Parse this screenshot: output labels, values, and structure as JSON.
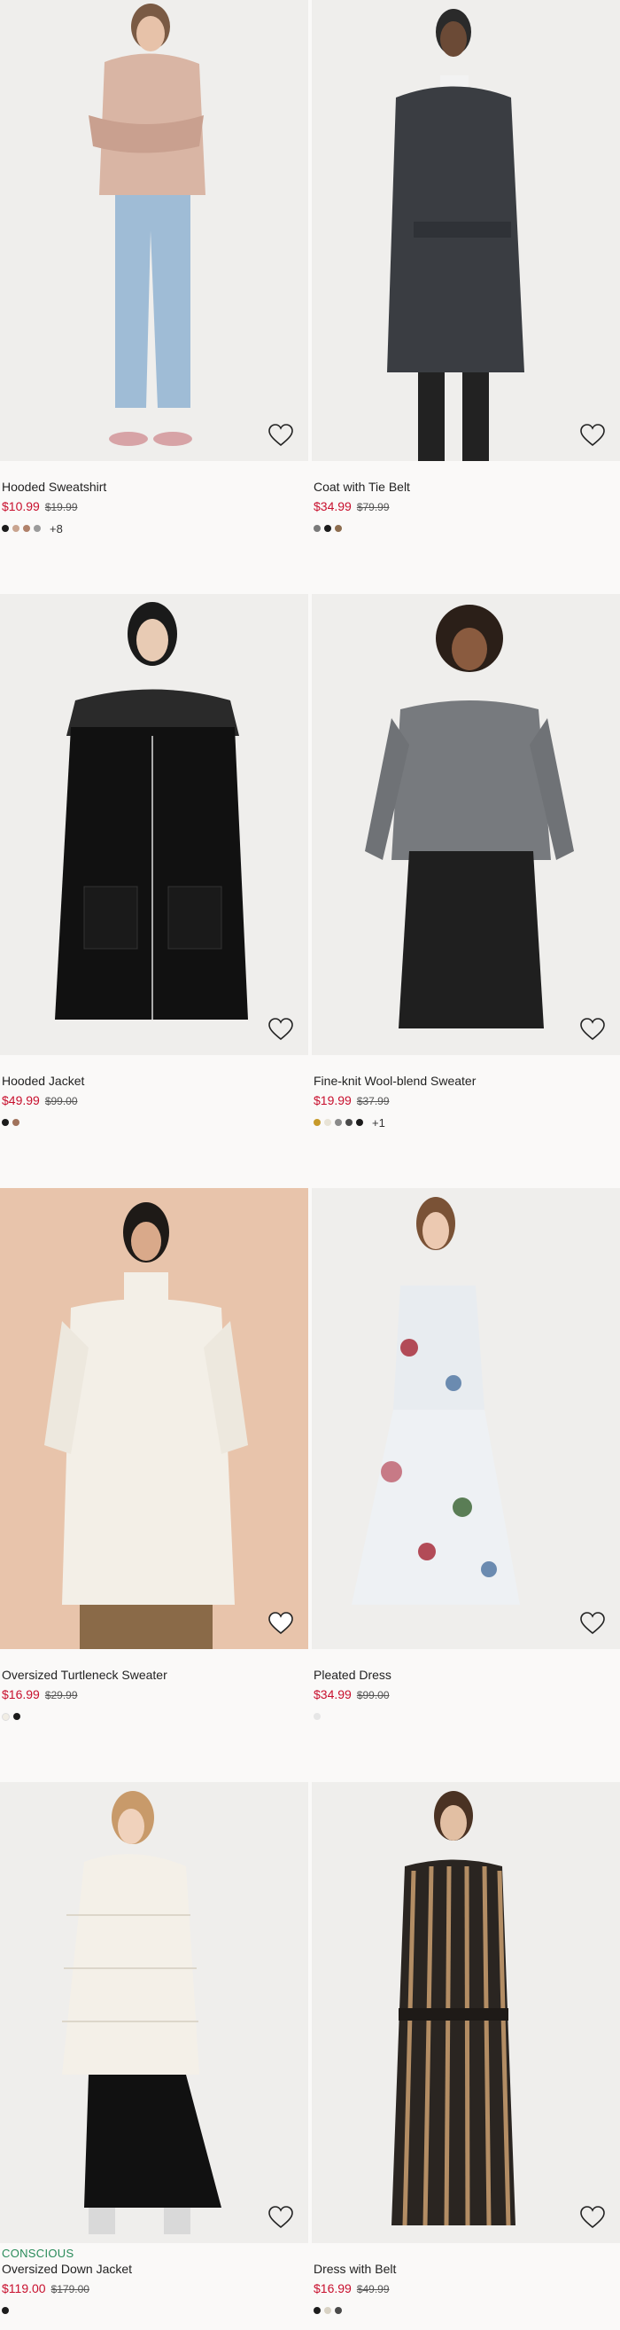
{
  "products": [
    {
      "name": "Hooded Sweatshirt",
      "price": "$10.99",
      "old_price": "$19.99",
      "badge": "",
      "swatches": [
        "#1c1c1c",
        "#c9a48f",
        "#b0816a",
        "#9b9b9b"
      ],
      "more": "+8",
      "bg": "#efeeec"
    },
    {
      "name": "Coat with Tie Belt",
      "price": "$34.99",
      "old_price": "$79.99",
      "badge": "",
      "swatches": [
        "#7a7a7a",
        "#1c1c1c",
        "#8d6d4f"
      ],
      "more": "",
      "bg": "#efeeec"
    },
    {
      "name": "Hooded Jacket",
      "price": "$49.99",
      "old_price": "$99.00",
      "badge": "",
      "swatches": [
        "#1c1c1c",
        "#a0725b"
      ],
      "more": "",
      "bg": "#efeeec"
    },
    {
      "name": "Fine-knit Wool-blend Sweater",
      "price": "$19.99",
      "old_price": "$37.99",
      "badge": "",
      "swatches": [
        "#c79a2a",
        "#e8e3d6",
        "#8a8a8a",
        "#4a4a4a",
        "#1c1c1c"
      ],
      "more": "+1",
      "bg": "#efeeec"
    },
    {
      "name": "Oversized Turtleneck Sweater",
      "price": "$16.99",
      "old_price": "$29.99",
      "badge": "",
      "swatches": [
        "#f1ede4",
        "#1c1c1c"
      ],
      "more": "",
      "bg": "#e8c4ab"
    },
    {
      "name": "Pleated Dress",
      "price": "$34.99",
      "old_price": "$99.00",
      "badge": "",
      "swatches": [
        "#e6e6e6"
      ],
      "more": "",
      "bg": "#efeeec"
    },
    {
      "name": "Oversized Down Jacket",
      "price": "$119.00",
      "old_price": "$179.00",
      "badge": "CONSCIOUS",
      "swatches": [
        "#1c1c1c"
      ],
      "more": "",
      "bg": "#efeeec"
    },
    {
      "name": "Dress with Belt",
      "price": "$16.99",
      "old_price": "$49.99",
      "badge": "",
      "swatches": [
        "#1c1c1c",
        "#d8d2c4",
        "#4a4a4a"
      ],
      "more": "",
      "bg": "#efeeec"
    }
  ]
}
